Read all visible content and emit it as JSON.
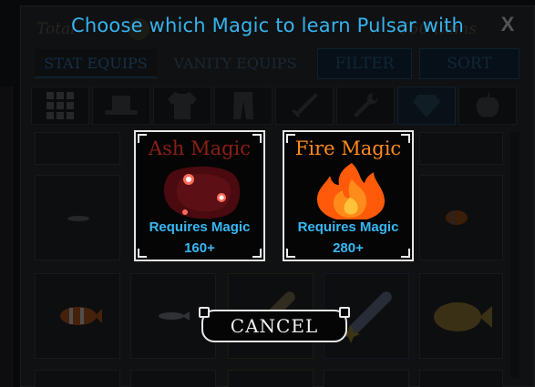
{
  "header": {
    "total_label": "Total",
    "total_value": "550 items",
    "close_label": "X"
  },
  "tabs": [
    {
      "label": "STAT EQUIPS",
      "active": true
    },
    {
      "label": "VANITY EQUIPS",
      "active": false
    }
  ],
  "toolbar": {
    "filter_label": "FILTER",
    "sort_label": "SORT"
  },
  "categories": [
    {
      "icon": "grid-all-icon",
      "active": false
    },
    {
      "icon": "hat-icon",
      "active": false
    },
    {
      "icon": "shirt-icon",
      "active": false
    },
    {
      "icon": "pants-icon",
      "active": false
    },
    {
      "icon": "sword-icon",
      "active": false
    },
    {
      "icon": "wrench-icon",
      "active": false
    },
    {
      "icon": "gem-icon",
      "active": true
    },
    {
      "icon": "apple-icon",
      "active": false
    }
  ],
  "modal": {
    "title": "Choose which Magic to learn Pulsar with",
    "options": [
      {
        "name": "Ash Magic",
        "name_color": "#8b1f14",
        "requirement_line1": "Requires Magic",
        "requirement_line2": "160+",
        "icon": "ash-cloud-icon"
      },
      {
        "name": "Fire Magic",
        "name_color": "#ff8a1c",
        "requirement_line1": "Requires Magic",
        "requirement_line2": "280+",
        "icon": "flame-icon"
      }
    ],
    "cancel_label": "CANCEL"
  },
  "colors": {
    "accent_blue": "#36b3ee",
    "card_border": "#e6e6e6"
  }
}
